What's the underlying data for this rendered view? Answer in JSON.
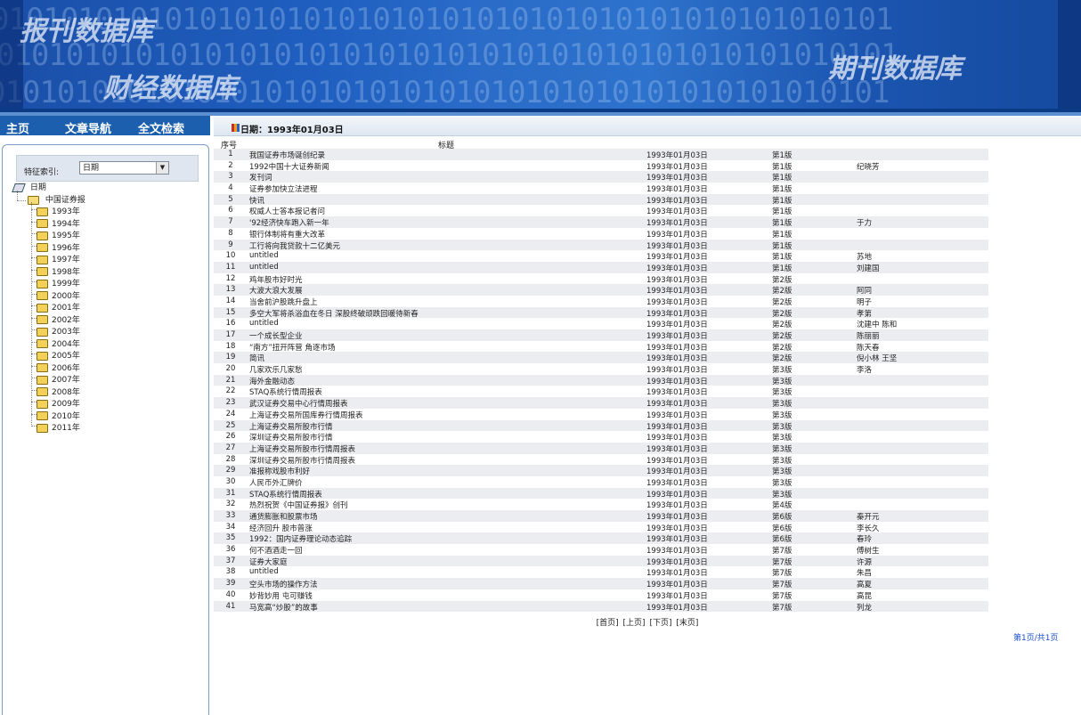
{
  "banner": {
    "logo_top": "报刊数据库",
    "logo_bottom": "财经数据库",
    "logo_right": "期刊数据库",
    "binary_text": "0101010101010101010101010101010101010101010101010101"
  },
  "nav": {
    "items": [
      "主页",
      "文章导航",
      "全文检索"
    ]
  },
  "date_header": "日期：1993年01月03日",
  "search": {
    "label": "特征索引:",
    "selected": "日期"
  },
  "tree": {
    "root": "日期",
    "child": "中国证券报",
    "years": [
      "1993年",
      "1994年",
      "1995年",
      "1996年",
      "1997年",
      "1998年",
      "1999年",
      "2000年",
      "2001年",
      "2002年",
      "2003年",
      "2004年",
      "2005年",
      "2006年",
      "2007年",
      "2008年",
      "2009年",
      "2010年",
      "2011年"
    ]
  },
  "table": {
    "headers": {
      "no": "序号",
      "title": "标题"
    },
    "rows": [
      {
        "no": "1",
        "title": "我国证券市场诞创纪录",
        "date": "1993年01月03日",
        "page": "第1版",
        "author": ""
      },
      {
        "no": "2",
        "title": "1992中国十大证券新闻",
        "date": "1993年01月03日",
        "page": "第1版",
        "author": "纪晓芳"
      },
      {
        "no": "3",
        "title": "发刊词",
        "date": "1993年01月03日",
        "page": "第1版",
        "author": ""
      },
      {
        "no": "4",
        "title": "证券参加快立法进程",
        "date": "1993年01月03日",
        "page": "第1版",
        "author": ""
      },
      {
        "no": "5",
        "title": "快讯",
        "date": "1993年01月03日",
        "page": "第1版",
        "author": ""
      },
      {
        "no": "6",
        "title": "权威人士答本报记者问",
        "date": "1993年01月03日",
        "page": "第1版",
        "author": ""
      },
      {
        "no": "7",
        "title": "'92经济快车跑入新一年",
        "date": "1993年01月03日",
        "page": "第1版",
        "author": "于力"
      },
      {
        "no": "8",
        "title": "银行体制将有重大改革",
        "date": "1993年01月03日",
        "page": "第1版",
        "author": ""
      },
      {
        "no": "9",
        "title": "工行将向我贷款十二亿美元",
        "date": "1993年01月03日",
        "page": "第1版",
        "author": ""
      },
      {
        "no": "10",
        "title": "untitled",
        "date": "1993年01月03日",
        "page": "第1版",
        "author": "苏地"
      },
      {
        "no": "11",
        "title": "untitled",
        "date": "1993年01月03日",
        "page": "第1版",
        "author": "刘建国"
      },
      {
        "no": "12",
        "title": "鸡年股市好时光",
        "date": "1993年01月03日",
        "page": "第2版",
        "author": ""
      },
      {
        "no": "13",
        "title": "大波大浪大发展",
        "date": "1993年01月03日",
        "page": "第2版",
        "author": "阿同"
      },
      {
        "no": "14",
        "title": "当舍前沪股跳升盘上",
        "date": "1993年01月03日",
        "page": "第2版",
        "author": "明子"
      },
      {
        "no": "15",
        "title": "多空大军将杀浴血在冬日 深股终破顽跌回暖待新春",
        "date": "1993年01月03日",
        "page": "第2版",
        "author": "孝第"
      },
      {
        "no": "16",
        "title": "untitled",
        "date": "1993年01月03日",
        "page": "第2版",
        "author": "沈建中  陈和"
      },
      {
        "no": "17",
        "title": "一个成长型企业",
        "date": "1993年01月03日",
        "page": "第2版",
        "author": "陈丽丽"
      },
      {
        "no": "18",
        "title": "“南方”扭开阵营 角逐市场",
        "date": "1993年01月03日",
        "page": "第2版",
        "author": "陈天春"
      },
      {
        "no": "19",
        "title": "简讯",
        "date": "1993年01月03日",
        "page": "第2版",
        "author": "倪小林  王坚"
      },
      {
        "no": "20",
        "title": "几家欢乐几家愁",
        "date": "1993年01月03日",
        "page": "第3版",
        "author": "李洛"
      },
      {
        "no": "21",
        "title": "海外金融动态",
        "date": "1993年01月03日",
        "page": "第3版",
        "author": ""
      },
      {
        "no": "22",
        "title": "STAQ系统行情周报表",
        "date": "1993年01月03日",
        "page": "第3版",
        "author": ""
      },
      {
        "no": "23",
        "title": "武汉证券交易中心行情周报表",
        "date": "1993年01月03日",
        "page": "第3版",
        "author": ""
      },
      {
        "no": "24",
        "title": "上海证券交易所国库券行情周报表",
        "date": "1993年01月03日",
        "page": "第3版",
        "author": ""
      },
      {
        "no": "25",
        "title": "上海证券交易所股市行情",
        "date": "1993年01月03日",
        "page": "第3版",
        "author": ""
      },
      {
        "no": "26",
        "title": "深圳证券交易所股市行情",
        "date": "1993年01月03日",
        "page": "第3版",
        "author": ""
      },
      {
        "no": "27",
        "title": "上海证券交易所股市行情周报表",
        "date": "1993年01月03日",
        "page": "第3版",
        "author": ""
      },
      {
        "no": "28",
        "title": "深圳证券交易所股市行情周报表",
        "date": "1993年01月03日",
        "page": "第3版",
        "author": ""
      },
      {
        "no": "29",
        "title": "准报称戏股市利好",
        "date": "1993年01月03日",
        "page": "第3版",
        "author": ""
      },
      {
        "no": "30",
        "title": "人民币外汇牌价",
        "date": "1993年01月03日",
        "page": "第3版",
        "author": ""
      },
      {
        "no": "31",
        "title": "STAQ系统行情周报表",
        "date": "1993年01月03日",
        "page": "第3版",
        "author": ""
      },
      {
        "no": "32",
        "title": "热烈祝贺《中国证券报》创刊",
        "date": "1993年01月03日",
        "page": "第4版",
        "author": ""
      },
      {
        "no": "33",
        "title": "通货膨胀和股票市场",
        "date": "1993年01月03日",
        "page": "第6版",
        "author": "秦开元"
      },
      {
        "no": "34",
        "title": "经济回升 股市普涨",
        "date": "1993年01月03日",
        "page": "第6版",
        "author": "李长久"
      },
      {
        "no": "35",
        "title": "1992：国内证券理论动态追踪",
        "date": "1993年01月03日",
        "page": "第6版",
        "author": "春玲"
      },
      {
        "no": "36",
        "title": "何不酒酒走一回",
        "date": "1993年01月03日",
        "page": "第7版",
        "author": "傅树生"
      },
      {
        "no": "37",
        "title": "证券大家庭",
        "date": "1993年01月03日",
        "page": "第7版",
        "author": "许源"
      },
      {
        "no": "38",
        "title": "untitled",
        "date": "1993年01月03日",
        "page": "第7版",
        "author": "朱昌"
      },
      {
        "no": "39",
        "title": "空头市场的操作方法",
        "date": "1993年01月03日",
        "page": "第7版",
        "author": "高夏"
      },
      {
        "no": "40",
        "title": "妙背妙用 屯可赚钱",
        "date": "1993年01月03日",
        "page": "第7版",
        "author": "高昆"
      },
      {
        "no": "41",
        "title": "马宽高“炒股”的故事",
        "date": "1993年01月03日",
        "page": "第7版",
        "author": "列龙"
      }
    ]
  },
  "pager": {
    "first": "[首页]",
    "prev": "[上页]",
    "next": "[下页]",
    "last": "[末页]",
    "info": "第1页/共1页"
  },
  "colors": {
    "nav_bg": "#1b5fae",
    "banner_bg": "#1f5fc0",
    "row_alt": "#ecedf0",
    "page_info": "#1a4fd0"
  }
}
